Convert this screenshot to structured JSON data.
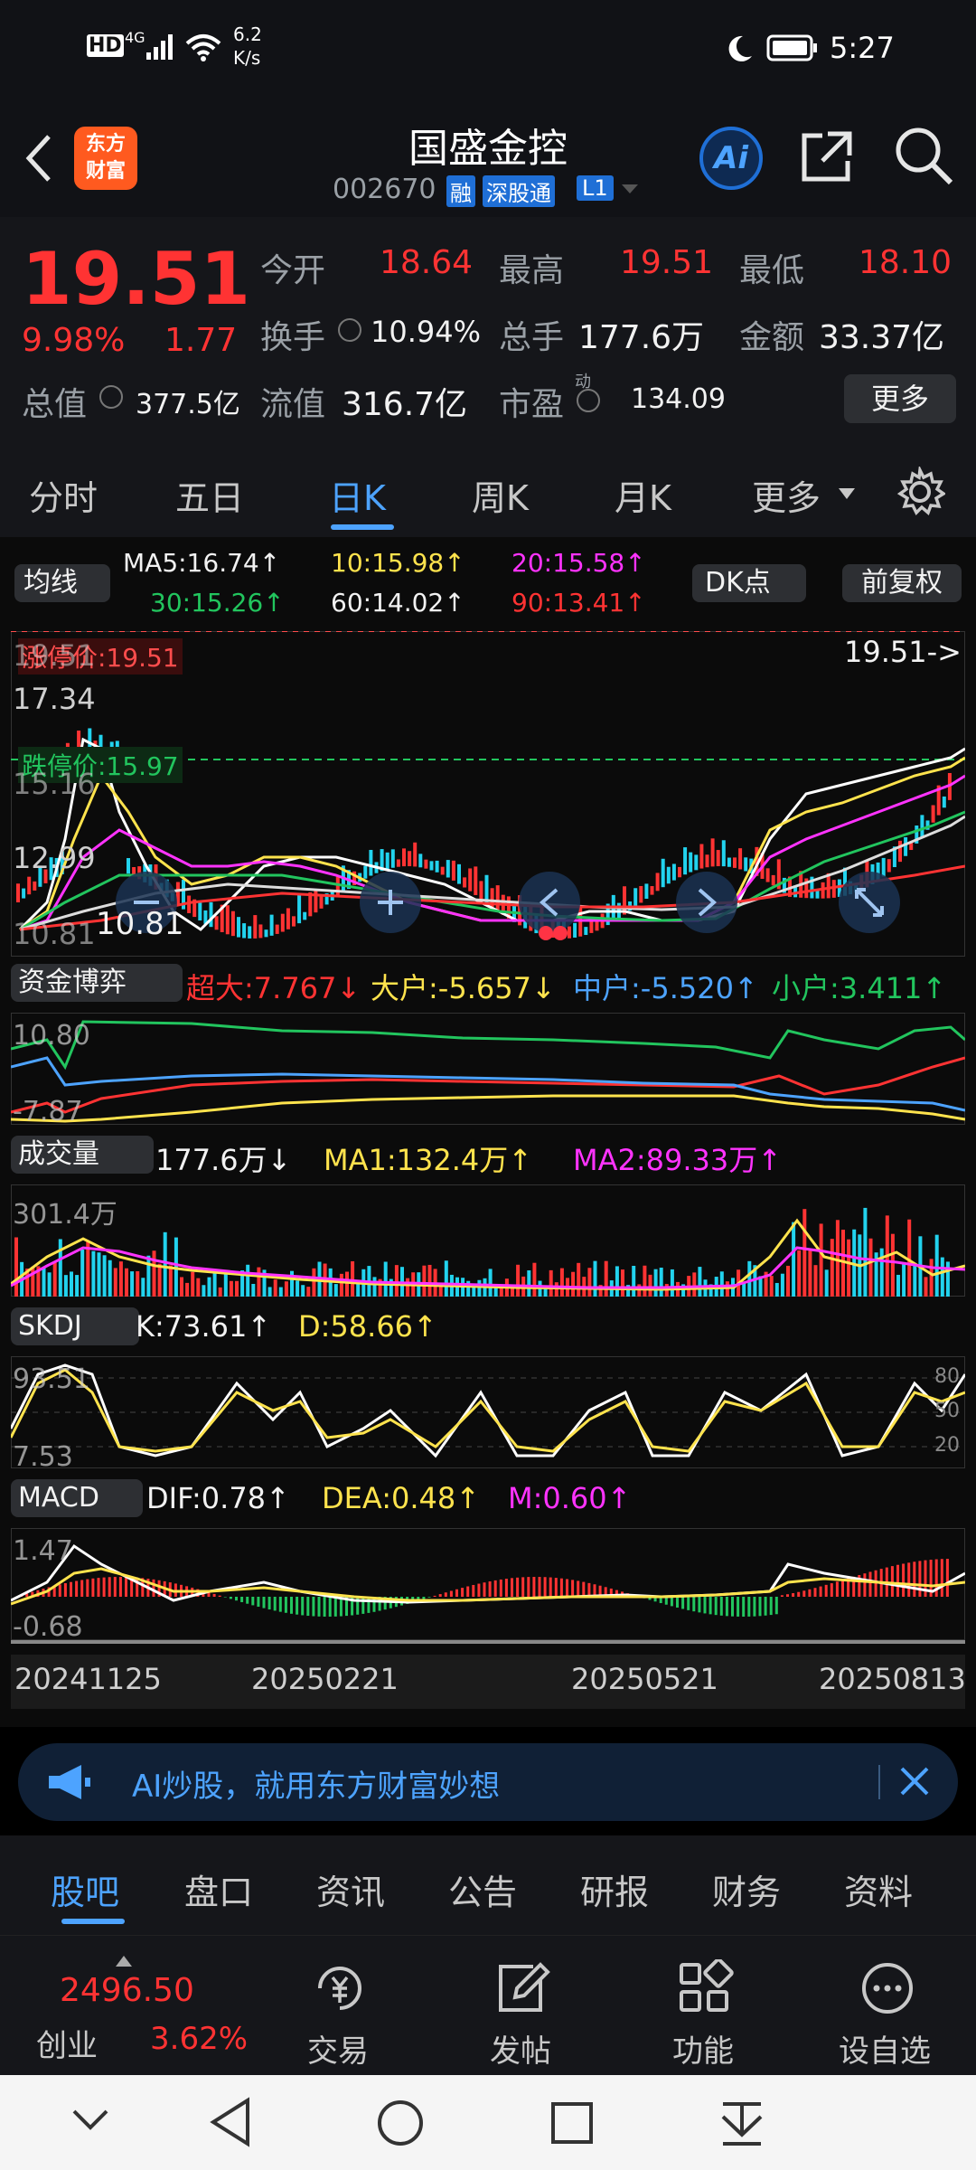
{
  "status": {
    "network": "HD",
    "signal": "4G",
    "speed": "6.2",
    "speed_unit": "K/s",
    "time": "5:27"
  },
  "header": {
    "logo_line1": "东方",
    "logo_line2": "财富",
    "title": "国盛金控",
    "code": "002670",
    "badge_rong": "融",
    "badge_sgt": "深股通",
    "badge_l1": "L1",
    "ai_label": "Ai"
  },
  "quote": {
    "price": "19.51",
    "change_pct": "9.98%",
    "change": "1.77",
    "open_label": "今开",
    "open": "18.64",
    "high_label": "最高",
    "high": "19.51",
    "low_label": "最低",
    "low": "18.10",
    "turnover_label": "换手",
    "turnover": "10.94%",
    "volume_label": "总手",
    "volume": "177.6万",
    "amount_label": "金额",
    "amount": "33.37亿",
    "mktcap_label": "总值",
    "mktcap": "377.5亿",
    "float_label": "流值",
    "float": "316.7亿",
    "pe_label": "市盈",
    "pe_sup": "动",
    "pe": "134.09",
    "more": "更多"
  },
  "tabs": [
    "分时",
    "五日",
    "日K",
    "周K",
    "月K",
    "更多"
  ],
  "active_tab": 2,
  "kline": {
    "indicator": "均线",
    "ma5": "MA5:16.74↑",
    "ma10": "10:15.98↑",
    "ma20": "20:15.58↑",
    "ma30": "30:15.26↑",
    "ma60": "60:14.02↑",
    "ma90": "90:13.41↑",
    "dk": "DK点",
    "fq": "前复权",
    "y_labels": [
      "19.51",
      "17.34",
      "15.16",
      "12.99",
      "10.81"
    ],
    "limit_up": "涨停价:19.51",
    "limit_down": "跌停价:15.97",
    "last_price": "19.51->",
    "min_price": "10.81"
  },
  "capital": {
    "title": "资金博弈",
    "super": "超大:7.767↓",
    "big": "大户:-5.657↓",
    "mid": "中户:-5.520↑",
    "small": "小户:3.411↑",
    "y_top": "10.80",
    "y_bottom": "-7.87"
  },
  "volume": {
    "title": "成交量",
    "vol": "177.6万↓",
    "ma1": "MA1:132.4万↑",
    "ma2": "MA2:89.33万↑",
    "y_top": "301.4万"
  },
  "skdj": {
    "title": "SKDJ",
    "k": "K:73.61↑",
    "d": "D:58.66↑",
    "y_top": "93.51",
    "y_bottom": "7.53",
    "r80": "80",
    "r50": "50",
    "r20": "20"
  },
  "macd": {
    "title": "MACD",
    "dif": "DIF:0.78↑",
    "dea": "DEA:0.48↑",
    "m": "M:0.60↑",
    "y_top": "1.47",
    "y_bottom": "-0.68"
  },
  "dates": [
    "20241125",
    "20250221",
    "20250521",
    "20250813"
  ],
  "ad": {
    "text": "AI炒股，就用东方财富妙想"
  },
  "section_tabs": [
    "股吧",
    "盘口",
    "资讯",
    "公告",
    "研报",
    "财务",
    "资料"
  ],
  "active_section": 0,
  "bottom": {
    "index_value": "2496.50",
    "index_name": "创业",
    "index_change": "3.62%",
    "trade": "交易",
    "post": "发帖",
    "func": "功能",
    "watch": "设自选"
  },
  "colors": {
    "up": "#ff3333",
    "down": "#22c55e",
    "accent": "#4da3ff"
  }
}
